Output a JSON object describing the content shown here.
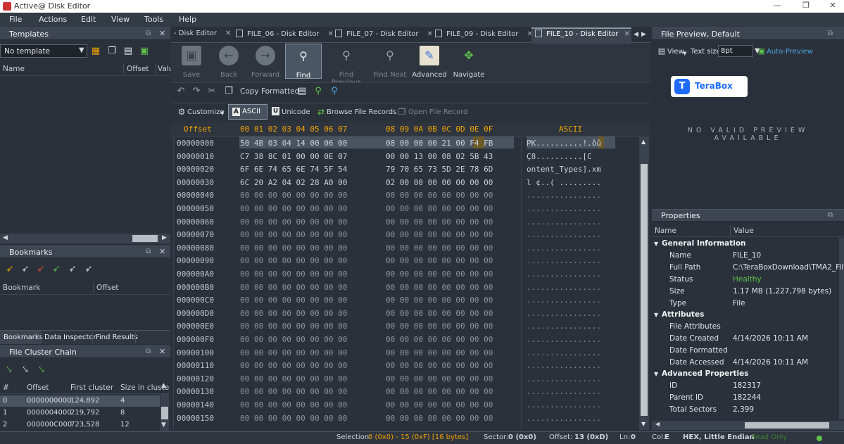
{
  "window": {
    "title": "Active@ Disk Editor",
    "controls": {
      "minimize": "—",
      "maximize": "❐",
      "close": "✕"
    }
  },
  "menu": [
    "File",
    "Actions",
    "Edit",
    "View",
    "Tools",
    "Help"
  ],
  "templates": {
    "title": "Templates",
    "select_value": "No template",
    "col_name": "Name",
    "col_offset": "Offset",
    "col_value": "Valu"
  },
  "bookmarks": {
    "title": "Bookmarks",
    "col_bookmark": "Bookmark",
    "col_offset": "Offset"
  },
  "bottom_tabs": [
    "Bookmarks",
    "Data Inspector",
    "Find Results"
  ],
  "cluster": {
    "title": "File Cluster Chain",
    "cols": [
      "#",
      "Offset",
      "First  cluster",
      "Size in cluste"
    ],
    "rows": [
      [
        "0",
        "0000000000",
        "124,892",
        "4"
      ],
      [
        "1",
        "0000004000",
        "219,792",
        "8"
      ],
      [
        "2",
        "000000C000",
        "723,528",
        "12"
      ]
    ]
  },
  "editor_tabs": [
    "- Disk Editor",
    "FILE_06 - Disk Editor",
    "FILE_07 - Disk Editor",
    "FILE_09 - Disk Editor",
    "FILE_10 - Disk Editor"
  ],
  "toolbar": [
    "Save",
    "Back",
    "Forward",
    "Find",
    "Find Previous",
    "Find Next",
    "Advanced",
    "Navigate"
  ],
  "toolbar2": {
    "copy_formatted": "Copy Formatted"
  },
  "toolbar3": {
    "customize": "Customize",
    "ascii": "ASCII",
    "unicode": "Unicode",
    "browse": "Browse File Records",
    "open": "Open File Record"
  },
  "hex": {
    "offset_header": "Offset",
    "col_headers_a": "00 01 02 03 04 05 06 07",
    "col_headers_b": "08 09 0A 0B 0C 0D 0E 0F",
    "ascii_header": "ASCII",
    "rows": [
      [
        "00000000",
        "50 4B 03 04 14 00 06 00",
        "08 00 00 00 21 00 F4 FB",
        "PK..........!.ôû"
      ],
      [
        "00000010",
        "C7 38 8C 01 00 00 0E 07",
        "00 00 13 00 08 02 5B 43",
        "Ç8..........[C"
      ],
      [
        "00000020",
        "6F 6E 74 65 6E 74 5F 54",
        "79 70 65 73 5D 2E 78 6D",
        "ontent_Types].xm"
      ],
      [
        "00000030",
        "6C 20 A2 04 02 28 A0 00",
        "02 00 00 00 00 00 00 00",
        "l ¢..( ........."
      ],
      [
        "00000040",
        "00 00 00 00 00 00 00 00",
        "00 00 00 00 00 00 00 00",
        "................"
      ],
      [
        "00000050",
        "00 00 00 00 00 00 00 00",
        "00 00 00 00 00 00 00 00",
        "................"
      ],
      [
        "00000060",
        "00 00 00 00 00 00 00 00",
        "00 00 00 00 00 00 00 00",
        "................"
      ],
      [
        "00000070",
        "00 00 00 00 00 00 00 00",
        "00 00 00 00 00 00 00 00",
        "................"
      ],
      [
        "00000080",
        "00 00 00 00 00 00 00 00",
        "00 00 00 00 00 00 00 00",
        "................"
      ],
      [
        "00000090",
        "00 00 00 00 00 00 00 00",
        "00 00 00 00 00 00 00 00",
        "................"
      ],
      [
        "000000A0",
        "00 00 00 00 00 00 00 00",
        "00 00 00 00 00 00 00 00",
        "................"
      ],
      [
        "000000B0",
        "00 00 00 00 00 00 00 00",
        "00 00 00 00 00 00 00 00",
        "................"
      ],
      [
        "000000C0",
        "00 00 00 00 00 00 00 00",
        "00 00 00 00 00 00 00 00",
        "................"
      ],
      [
        "000000D0",
        "00 00 00 00 00 00 00 00",
        "00 00 00 00 00 00 00 00",
        "................"
      ],
      [
        "000000E0",
        "00 00 00 00 00 00 00 00",
        "00 00 00 00 00 00 00 00",
        "................"
      ],
      [
        "000000F0",
        "00 00 00 00 00 00 00 00",
        "00 00 00 00 00 00 00 00",
        "................"
      ],
      [
        "00000100",
        "00 00 00 00 00 00 00 00",
        "00 00 00 00 00 00 00 00",
        "................"
      ],
      [
        "00000110",
        "00 00 00 00 00 00 00 00",
        "00 00 00 00 00 00 00 00",
        "................"
      ],
      [
        "00000120",
        "00 00 00 00 00 00 00 00",
        "00 00 00 00 00 00 00 00",
        "................"
      ],
      [
        "00000130",
        "00 00 00 00 00 00 00 00",
        "00 00 00 00 00 00 00 00",
        "................"
      ],
      [
        "00000140",
        "00 00 00 00 00 00 00 00",
        "00 00 00 00 00 00 00 00",
        "................"
      ],
      [
        "00000150",
        "00 00 00 00 00 00 00 00",
        "00 00 00 00 00 00 00 00",
        "................"
      ]
    ]
  },
  "preview": {
    "title": "File Preview, Default",
    "view": "View",
    "text_size_label": "Text size",
    "text_size": "8pt",
    "auto": "Auto-Preview",
    "logo": "TeraBox",
    "message": "NO  VALID  PREVIEW\nAVAILABLE"
  },
  "properties": {
    "title": "Properties",
    "col_name": "Name",
    "col_value": "Value",
    "general": "General Information",
    "attributes": "Attributes",
    "advanced": "Advanced Properties",
    "rows": [
      [
        "Name",
        "FILE_10"
      ],
      [
        "Full Path",
        "C:\\TeraBoxDownload\\TMA2_File_"
      ],
      [
        "Status",
        "Healthy"
      ],
      [
        "Size",
        "1.17 MB (1,227,798 bytes)"
      ],
      [
        "Type",
        "File"
      ]
    ],
    "attr_rows": [
      [
        "File Attributes",
        ""
      ],
      [
        "Date Created",
        "4/14/2026 10:11 AM"
      ],
      [
        "Date Formatted",
        ""
      ],
      [
        "Date Accessed",
        "4/14/2026 10:11 AM"
      ]
    ],
    "adv_rows": [
      [
        "ID",
        "182317"
      ],
      [
        "Parent ID",
        "182244"
      ],
      [
        "Total Sectors",
        "2,399"
      ]
    ]
  },
  "status": {
    "selection_label": "Selection:",
    "selection": "0 (0x0) - 15 (0xF) [16 bytes]",
    "sector_label": "Sector:",
    "sector": "0 (0x0)",
    "offset_label": "Offset:",
    "offset": "13 (0xD)",
    "ln_label": "Ln:",
    "ln": "0",
    "col_label": "Col:",
    "col": "E",
    "mode": "HEX, Little Endian",
    "access": "Read Only"
  },
  "colors": {
    "accent": "#f0a200",
    "healthy": "#5fc24a",
    "terabox": "#1f6bff"
  }
}
